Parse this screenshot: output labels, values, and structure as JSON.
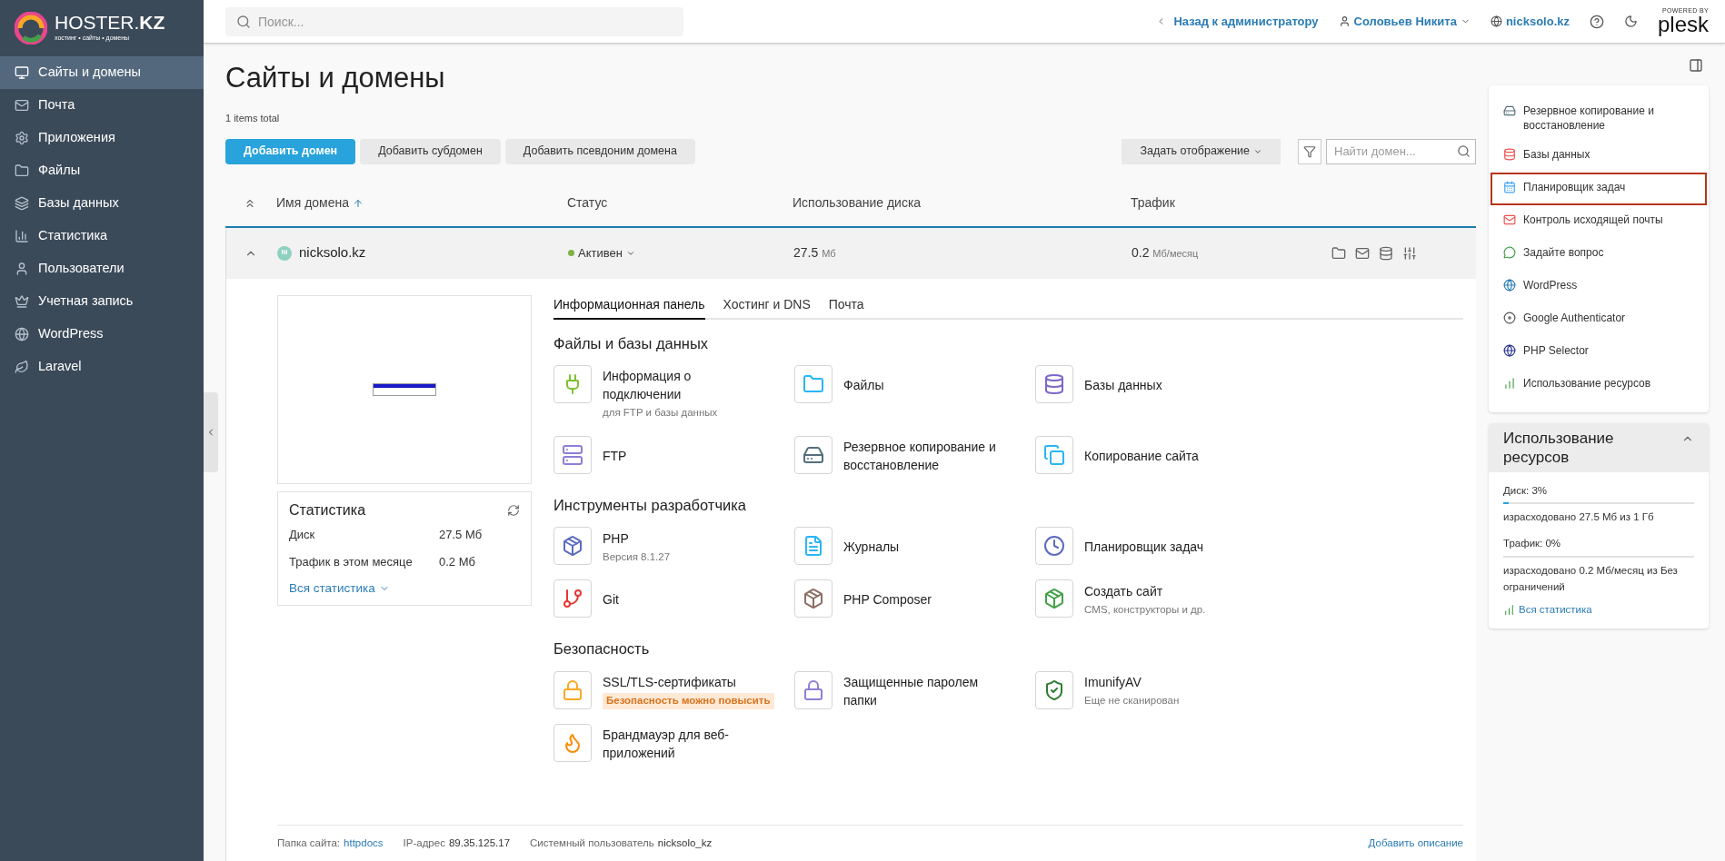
{
  "logo": {
    "name": "HOSTER.",
    "suffix": "KZ",
    "tagline": "хостинг • сайты • домены"
  },
  "search": {
    "placeholder": "Поиск..."
  },
  "topbar": {
    "back_link": "Назад к администратору",
    "user": "Соловьев Никита",
    "domain": "nicksolo.kz",
    "powered_by": "POWERED BY",
    "brand": "plesk"
  },
  "sidebar": {
    "items": [
      {
        "label": "Сайты и домены",
        "selected": true
      },
      {
        "label": "Почта",
        "selected": false
      },
      {
        "label": "Приложения",
        "selected": false
      },
      {
        "label": "Файлы",
        "selected": false
      },
      {
        "label": "Базы данных",
        "selected": false
      },
      {
        "label": "Статистика",
        "selected": false
      },
      {
        "label": "Пользователи",
        "selected": false
      },
      {
        "label": "Учетная запись",
        "selected": false
      },
      {
        "label": "WordPress",
        "selected": false
      },
      {
        "label": "Laravel",
        "selected": false
      }
    ]
  },
  "page": {
    "title": "Сайты и домены",
    "items_total": "1 items total"
  },
  "toolbar": {
    "buttons": [
      {
        "label": "Добавить домен",
        "primary": true
      },
      {
        "label": "Добавить субдомен",
        "primary": false
      },
      {
        "label": "Добавить псевдоним домена",
        "primary": false
      }
    ],
    "view_button": "Задать отображение",
    "search_placeholder": "Найти домен..."
  },
  "table": {
    "columns": [
      {
        "label": "Имя домена",
        "sorted": true
      },
      {
        "label": "Статус",
        "sorted": false
      },
      {
        "label": "Использование диска",
        "sorted": false
      },
      {
        "label": "Трафик",
        "sorted": false
      }
    ],
    "row": {
      "avatar": "NI",
      "domain": "nicksolo.kz",
      "status": {
        "label": "Активен",
        "color": "#7cb342"
      },
      "disk": "27.5",
      "disk_unit": "Мб",
      "traffic": "0.2",
      "traffic_unit": "Мб/месяц",
      "expanded": true
    }
  },
  "stats_card": {
    "title": "Статистика",
    "rows": [
      {
        "label": "Диск",
        "value": "27.5 Мб"
      },
      {
        "label": "Трафик в этом месяце",
        "value": "0.2 Мб"
      }
    ],
    "link": "Вся статистика"
  },
  "tabs": [
    {
      "label": "Информационная панель",
      "selected": true
    },
    {
      "label": "Хостинг и DNS",
      "selected": false
    },
    {
      "label": "Почта",
      "selected": false
    }
  ],
  "sections": [
    {
      "title": "Файлы и базы данных",
      "tools": [
        {
          "label": "Информация о подключении",
          "subtitle": "для FTP и базы данных"
        },
        {
          "label": "Файлы"
        },
        {
          "label": "Базы данных"
        },
        {
          "label": "FTP"
        },
        {
          "label": "Резервное копирование и восстановление"
        },
        {
          "label": "Копирование сайта"
        }
      ]
    },
    {
      "title": "Инструменты разработчика",
      "tools": [
        {
          "label": "PHP",
          "subtitle": "Версия 8.1.27"
        },
        {
          "label": "Журналы"
        },
        {
          "label": "Планировщик задач"
        },
        {
          "label": "Git"
        },
        {
          "label": "PHP Composer"
        },
        {
          "label": "Создать сайт",
          "subtitle": "CMS, конструкторы и др."
        }
      ]
    },
    {
      "title": "Безопасность",
      "tools": [
        {
          "label": "SSL/TLS-сертификаты",
          "badge": "Безопасность можно повысить"
        },
        {
          "label": "Защищенные паролем папки"
        },
        {
          "label": "ImunifyAV",
          "subtitle": "Еще не сканирован"
        },
        {
          "label": "Брандмауэр для веб-приложений"
        }
      ]
    }
  ],
  "footer": [
    {
      "label": "Папка сайта:",
      "value": "httpdocs",
      "link": true
    },
    {
      "label": "IP-адрес",
      "value": "89.35.125.17",
      "link": false
    },
    {
      "label": "Системный пользователь",
      "value": "nicksolo_kz",
      "link": false
    }
  ],
  "add_description": "Добавить описание",
  "quick_links": [
    {
      "label": "Резервное копирование и восстановление",
      "highlighted": false
    },
    {
      "label": "Базы данных",
      "highlighted": false
    },
    {
      "label": "Планировщик задач",
      "highlighted": true
    },
    {
      "label": "Контроль исходящей почты",
      "highlighted": false
    },
    {
      "label": "Задайте вопрос",
      "highlighted": false
    },
    {
      "label": "WordPress",
      "highlighted": false
    },
    {
      "label": "Google Authenticator",
      "highlighted": false
    },
    {
      "label": "PHP Selector",
      "highlighted": false
    },
    {
      "label": "Использование ресурсов",
      "highlighted": false
    }
  ],
  "resources": {
    "title": "Использование ресурсов",
    "expanded": true,
    "meters": [
      {
        "label": "Диск: 3%",
        "level": 0.03,
        "detail": "израсходовано 27.5 Мб из 1 Гб"
      },
      {
        "label": "Трафик: 0%",
        "level": 0,
        "detail": "израсходовано 0.2 Мб/месяц из Без ограничений"
      }
    ],
    "link": "Вся статистика"
  }
}
